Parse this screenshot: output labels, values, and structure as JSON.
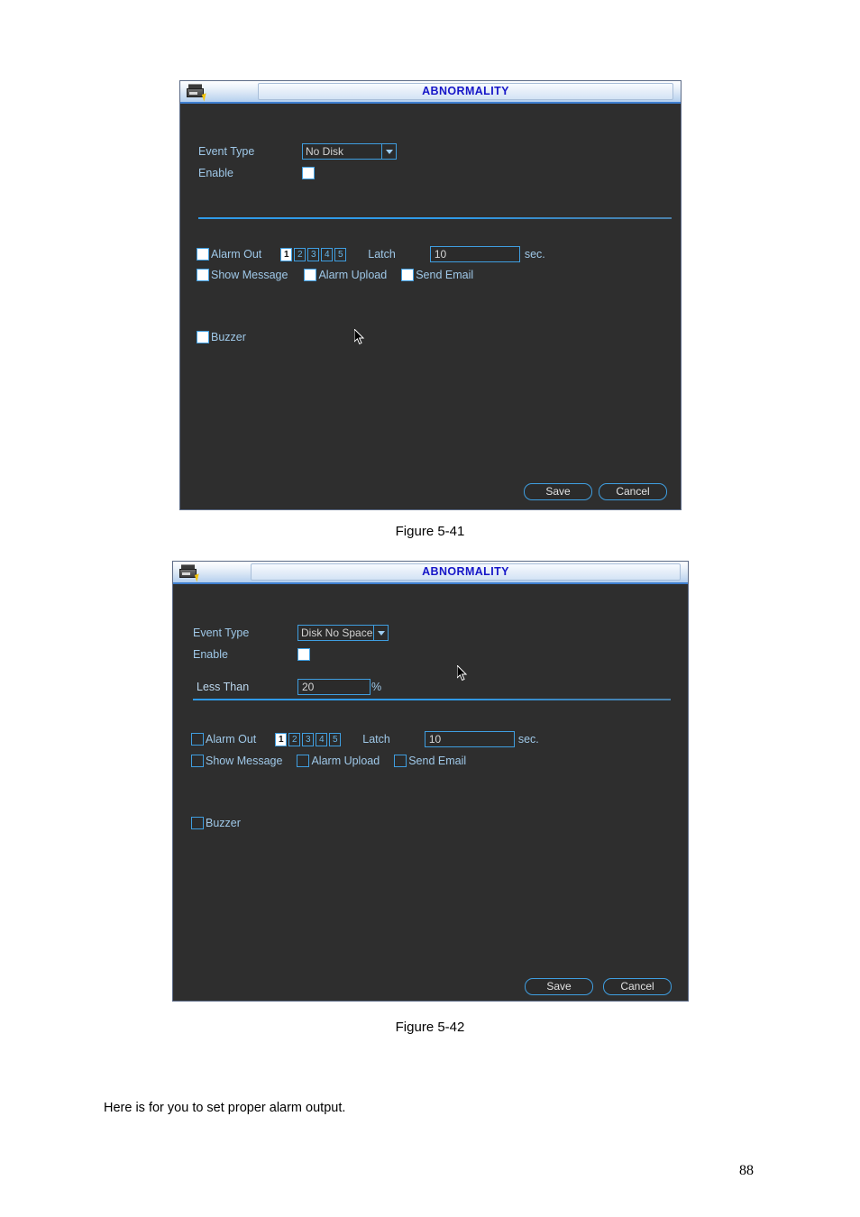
{
  "document": {
    "page_number": "88",
    "body_text": "Here is for you to set proper alarm output.",
    "figure_caption_1": "Figure 5-41",
    "figure_caption_2": "Figure 5-42"
  },
  "dialog1": {
    "title": "ABNORMALITY",
    "icon": "dvr-device-icon",
    "event_type_label": "Event Type",
    "event_type_value": "No Disk",
    "enable_label": "Enable",
    "enable_checked": true,
    "alarm_out_label": "Alarm Out",
    "alarm_out_buttons": [
      "1",
      "2",
      "3",
      "4",
      "5"
    ],
    "alarm_out_selected": "1",
    "latch_label": "Latch",
    "latch_value": "10",
    "latch_unit": "sec.",
    "show_message_label": "Show Message",
    "alarm_upload_label": "Alarm Upload",
    "send_email_label": "Send Email",
    "buzzer_label": "Buzzer",
    "save_label": "Save",
    "cancel_label": "Cancel"
  },
  "dialog2": {
    "title": "ABNORMALITY",
    "icon": "dvr-device-icon",
    "event_type_label": "Event Type",
    "event_type_value": "Disk No Space",
    "enable_label": "Enable",
    "enable_checked": true,
    "less_than_label": "Less Than",
    "less_than_value": "20",
    "less_than_unit": "%",
    "alarm_out_label": "Alarm Out",
    "alarm_out_buttons": [
      "1",
      "2",
      "3",
      "4",
      "5"
    ],
    "alarm_out_selected": "1",
    "latch_label": "Latch",
    "latch_value": "10",
    "latch_unit": "sec.",
    "show_message_label": "Show Message",
    "alarm_upload_label": "Alarm Upload",
    "send_email_label": "Send Email",
    "buzzer_label": "Buzzer",
    "save_label": "Save",
    "cancel_label": "Cancel"
  },
  "colors": {
    "accent_blue": "#3f9ee0",
    "panel_bg": "#2e2e2e",
    "label_blue": "#9fc8e8",
    "title_text": "#1616c8"
  }
}
